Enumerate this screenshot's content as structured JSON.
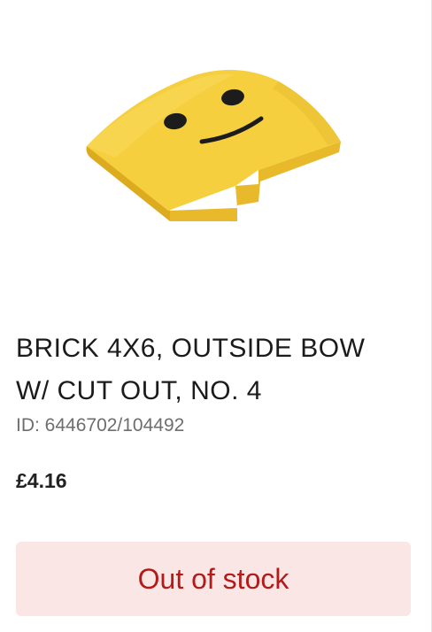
{
  "product": {
    "title": "BRICK 4X6, OUTSIDE BOW W/ CUT OUT, NO. 4",
    "id_text": "ID: 6446702/104492",
    "price": "£4.16",
    "stock_button_label": "Out of stock",
    "image_icon": "yellow-brick-smiley-face",
    "colors": {
      "brick_yellow": "#f6cf3f",
      "stock_text": "#b31b1b",
      "stock_bg": "#fbe6e6"
    }
  }
}
